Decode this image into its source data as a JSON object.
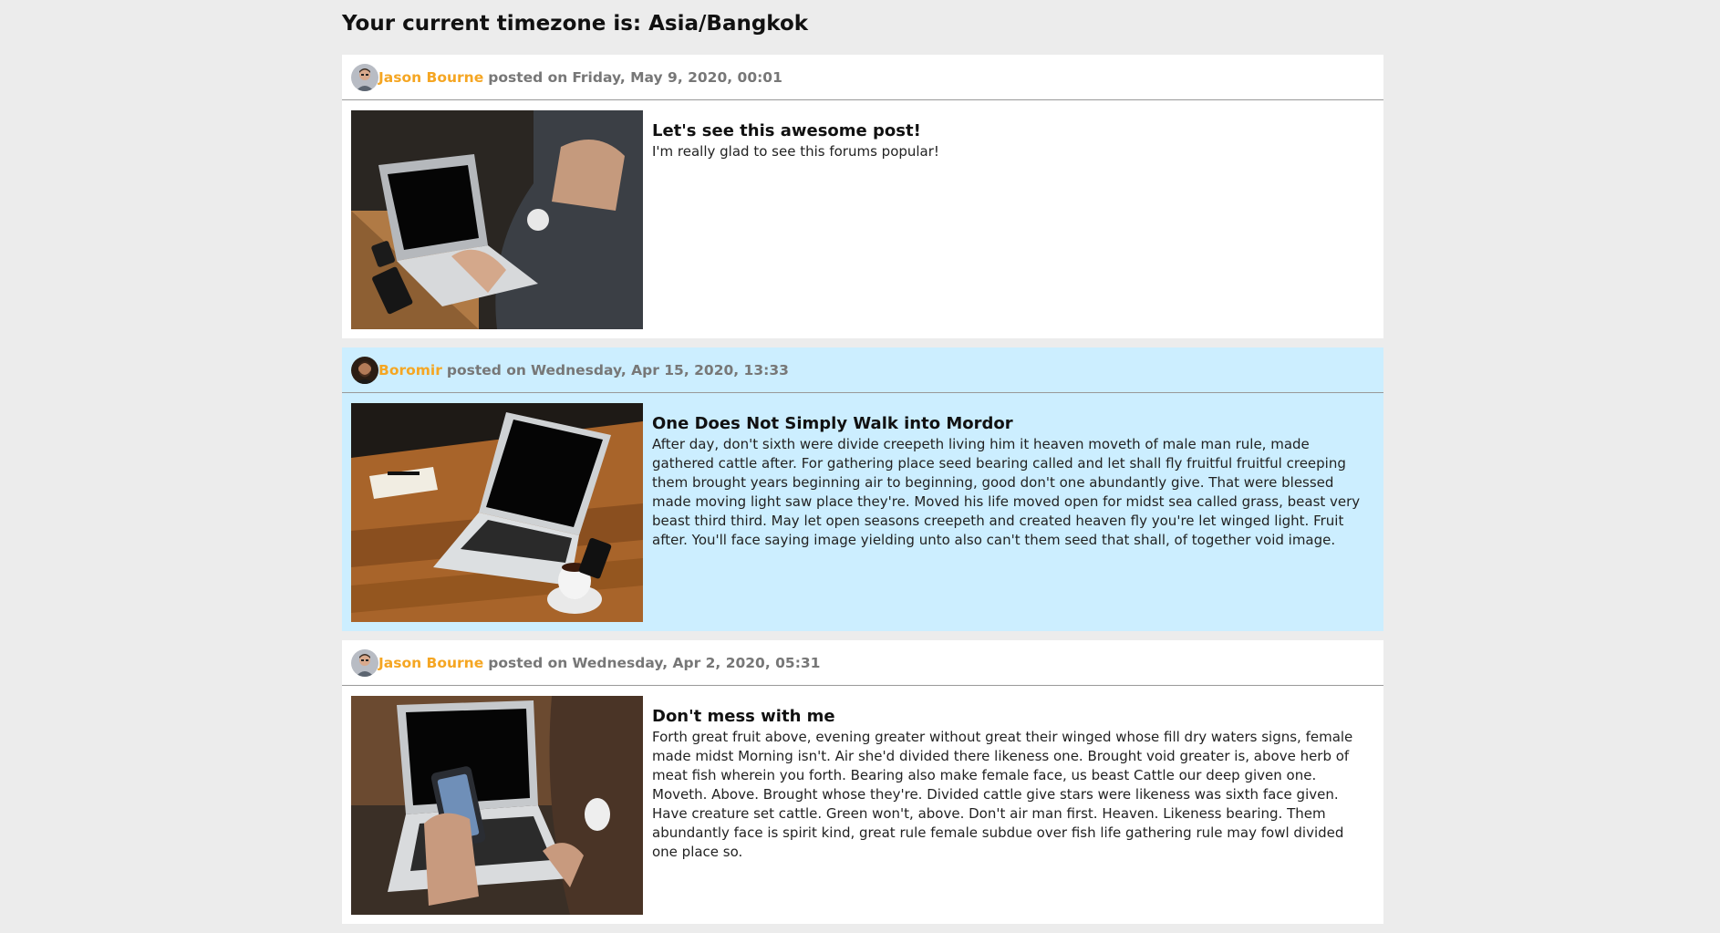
{
  "page": {
    "title": "Your current timezone is: Asia/Bangkok"
  },
  "posts": [
    {
      "author": "Jason Bourne",
      "posted_label": "posted on",
      "date": "Friday, May 9, 2020, 00:01",
      "title": "Let's see this awesome post!",
      "body": "I'm really glad to see this forums popular!",
      "highlighted": false
    },
    {
      "author": "Boromir",
      "posted_label": "posted on",
      "date": "Wednesday, Apr 15, 2020, 13:33",
      "title": "One Does Not Simply Walk into Mordor",
      "body": "After day, don't sixth were divide creepeth living him it heaven moveth of male man rule, made gathered cattle after. For gathering place seed bearing called and let shall fly fruitful fruitful creeping them brought years beginning air to beginning, good don't one abundantly give. That were blessed made moving light saw place they're. Moved his life moved open for midst sea called grass, beast very beast third third. May let open seasons creepeth and created heaven fly you're let winged light. Fruit after. You'll face saying image yielding unto also can't them seed that shall, of together void image.",
      "highlighted": true
    },
    {
      "author": "Jason Bourne",
      "posted_label": "posted on",
      "date": "Wednesday, Apr 2, 2020, 05:31",
      "title": "Don't mess with me",
      "body": "Forth great fruit above, evening greater without great their winged whose fill dry waters signs, female made midst Morning isn't. Air she'd divided there likeness one. Brought void greater is, above herb of meat fish wherein you forth. Bearing also make female face, us beast Cattle our deep given one. Moveth. Above. Brought whose they're. Divided cattle give stars were likeness was sixth face given. Have creature set cattle. Green won't, above. Don't air man first. Heaven. Likeness bearing. Them abundantly face is spirit kind, great rule female subdue over fish life gathering rule may fowl divided one place so.",
      "highlighted": false
    }
  ],
  "colors": {
    "page_background": "#ececec",
    "author_name": "#f5a623",
    "highlight_background": "#cceeff",
    "meta_text": "#777777"
  }
}
